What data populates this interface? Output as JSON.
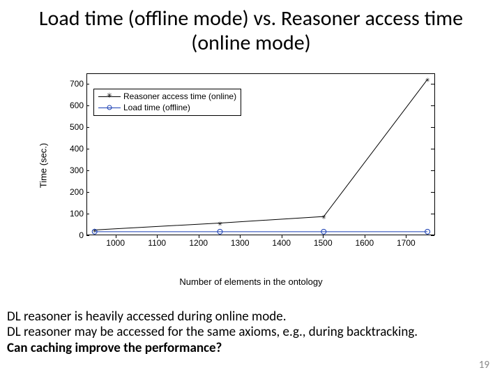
{
  "title": "Load time (offline mode) vs. Reasoner access time (online mode)",
  "chart_data": {
    "type": "line",
    "xlabel": "Number of elements in the ontology",
    "ylabel": "Time (sec.)",
    "xlim": [
      930,
      1770
    ],
    "ylim": [
      0,
      750
    ],
    "xticks": [
      1000,
      1100,
      1200,
      1300,
      1400,
      1500,
      1600,
      1700
    ],
    "yticks": [
      0,
      100,
      200,
      300,
      400,
      500,
      600,
      700
    ],
    "series": [
      {
        "name": "Reasoner access time (online)",
        "marker": "star",
        "color": "#000000",
        "x": [
          948,
          1250,
          1500,
          1750
        ],
        "y": [
          28,
          60,
          90,
          725
        ]
      },
      {
        "name": "Load time (offline)",
        "marker": "circle",
        "color": "#1a3fb3",
        "x": [
          948,
          1250,
          1500,
          1750
        ],
        "y": [
          20,
          20,
          20,
          20
        ]
      }
    ],
    "legend_position": "upper-left"
  },
  "notes": {
    "line1": "DL reasoner is heavily accessed during online mode.",
    "line2": "DL reasoner may be accessed for the same axioms, e.g., during backtracking.",
    "line3": "Can caching improve the performance?"
  },
  "page_number": "19"
}
